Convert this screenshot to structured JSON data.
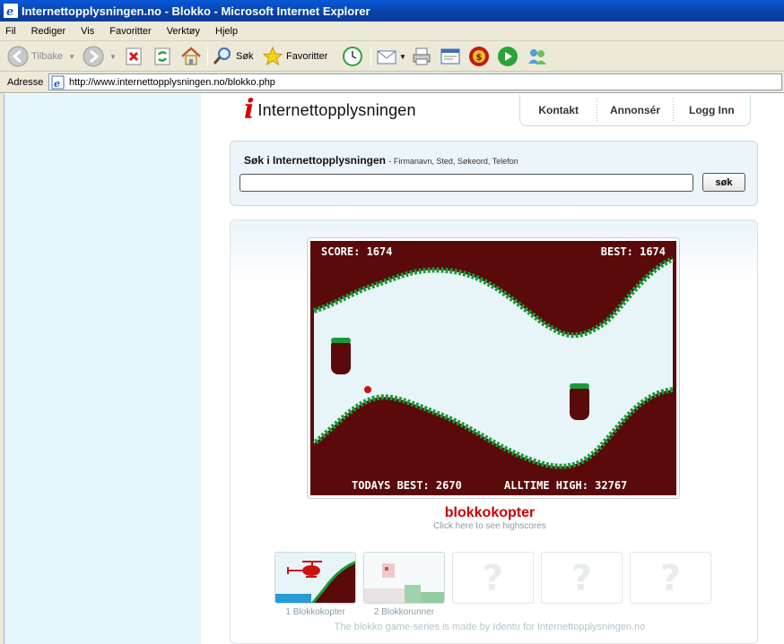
{
  "window": {
    "title": "Internettopplysningen.no - Blokko - Microsoft Internet Explorer"
  },
  "menu": [
    "Fil",
    "Rediger",
    "Vis",
    "Favoritter",
    "Verktøy",
    "Hjelp"
  ],
  "toolbar": {
    "back_label": "Tilbake",
    "search_label": "Søk",
    "favorites_label": "Favoritter"
  },
  "address": {
    "label": "Adresse",
    "url": "http://www.internettopplysningen.no/blokko.php"
  },
  "site": {
    "logo_mark": "i",
    "logo_text": "Internettopplysningen",
    "nav": [
      "Kontakt",
      "Annonsér",
      "Logg Inn"
    ],
    "search": {
      "title": "Søk i Internettopplysningen",
      "hint": "- Firmanavn, Sted, Søkeord, Telefon",
      "value": "",
      "button": "søk"
    }
  },
  "game": {
    "score_text": "SCORE: 1674",
    "best_text": "BEST: 1674",
    "todays_best_text": "TODAYS BEST: 2670",
    "alltime_high_text": "ALLTIME HIGH: 32767",
    "name": "blokkokopter",
    "subtitle": "Click here to see highscores",
    "colors": {
      "wall": "#5a0a0a",
      "grass": "#1c9a3a",
      "sky": "#e8f5f8",
      "ball": "#cc1111"
    }
  },
  "games_list": [
    {
      "label": "1 Blokkokopter",
      "locked": false
    },
    {
      "label": "2 Blokkorunner",
      "locked": false
    },
    {
      "label": "",
      "locked": true,
      "glyph": "?"
    },
    {
      "label": "",
      "locked": true,
      "glyph": "?"
    },
    {
      "label": "",
      "locked": true,
      "glyph": "?"
    }
  ],
  "credit": "The blokko game-series is made by Identu for Internettopplysningen.no"
}
